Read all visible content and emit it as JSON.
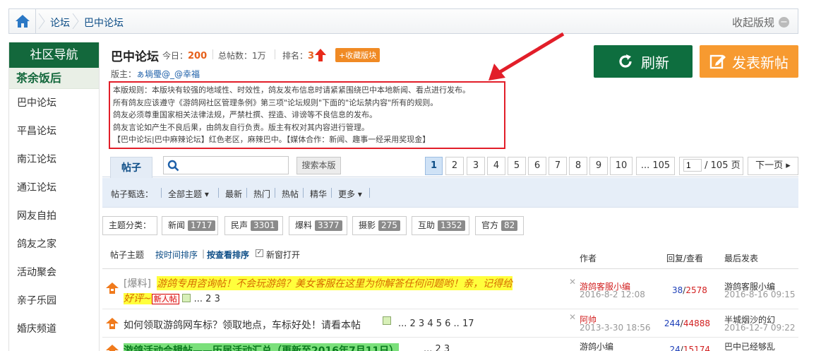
{
  "breadcrumb": {
    "items": [
      "论坛",
      "巴中论坛"
    ],
    "toggle_label": "收起版规",
    "toggle_icon": "minus-circle-icon"
  },
  "sidebar": {
    "title": "社区导航",
    "current": "茶余饭后",
    "items": [
      "巴中论坛",
      "平昌论坛",
      "南江论坛",
      "通江论坛",
      "网友自拍",
      "鸽友之家",
      "活动聚会",
      "亲子乐园",
      "婚庆频道"
    ]
  },
  "forum": {
    "name": "巴中论坛",
    "today_label": "今日：",
    "today_value": "200",
    "total_label": "总帖数：",
    "total_value": "1万",
    "rank_label": "排名：",
    "rank_value": "3",
    "fav_label": "+收藏版块",
    "moderator_label": "版主：",
    "moderator_name": "ぁ埫璺@_@幸福"
  },
  "actions": {
    "refresh_label": "刷新",
    "post_label": "发表新帖"
  },
  "rules": {
    "lines": [
      "本版规则：本版块有较强的地域性、时效性，鸽友发布信息时请紧紧围绕巴中本地新闻、看点进行发布。",
      "所有鸽友应该遵守《游鸽网社区管理条例》第三项\"论坛规则\"下面的\"论坛禁内容\"所有的规则。",
      "鸽友必须尊重国家相关法律法规，严禁杜撰、捏造、诽谤等不良信息的发布。",
      "鸽友言论如产生不良后果，由鸽友自行负责。版主有权对其内容进行管理。",
      "【巴中论坛|巴中麻辣论坛】红色老区，麻辣巴中。【媒体合作：新闻、趣事一经采用奖现金】"
    ]
  },
  "tabs": {
    "post_tab": "帖子",
    "search_placeholder": "",
    "search_button": "搜索本版"
  },
  "pager": {
    "pages": [
      "1",
      "2",
      "3",
      "4",
      "5",
      "6",
      "7",
      "8",
      "9",
      "10",
      "... 105"
    ],
    "current": "1",
    "input_value": "1",
    "total_label": "/ 105 页",
    "next_label": "下一页"
  },
  "filter": {
    "label": "帖子甄选：",
    "items": [
      "全部主题",
      "最新",
      "热门",
      "热帖",
      "精华",
      "更多"
    ]
  },
  "categories": {
    "label": "主题分类：",
    "items": [
      {
        "name": "新闻",
        "count": "1717"
      },
      {
        "name": "民声",
        "count": "3301"
      },
      {
        "name": "爆料",
        "count": "3377"
      },
      {
        "name": "摄影",
        "count": "275"
      },
      {
        "name": "互助",
        "count": "1352"
      },
      {
        "name": "官方",
        "count": "82"
      }
    ]
  },
  "thread_header": {
    "subject": "帖子主题",
    "sort_time": "按时间排序",
    "sort_view": "按查看排序",
    "new_window": "新窗打开",
    "author": "作者",
    "reply_view": "回复/查看",
    "last_post": "最后发表"
  },
  "threads": [
    {
      "tag": "[爆料]",
      "title_line1": "游鸽专用咨询帖！不会玩游鸽？美女客服在这里为你解答任何问题哟！亲，记得给",
      "title_line2": "好评~",
      "badge": "新人帖",
      "pages": "... 2 3",
      "author": "游鸽客服小编",
      "date": "2016-8-2 12:08",
      "replies": "38",
      "views": "2578",
      "last_author": "游鸽客服小编",
      "last_date": "2016-8-16 09:15"
    },
    {
      "title": "如何领取游鸽网车标？领取地点，车标好处！请看本帖",
      "pages": "... 2 3 4 5 6 .. 17",
      "author": "阿帅",
      "date": "2013-3-30 18:56",
      "replies": "244",
      "views": "44888",
      "last_author": "半城烟沙的幻",
      "last_date": "2016-12-7 09:22"
    },
    {
      "title": "游鸽活动合辑帖——历届活动汇总（更新至2016年7月11日）",
      "pages": "... 2 3",
      "author": "游鸽小编",
      "date": "",
      "replies": "24",
      "views": "15174",
      "last_author": "巴中已经够乱",
      "last_date": ""
    }
  ],
  "colors": {
    "sidebar_green": "#13683c",
    "refresh_green": "#0e6e3f",
    "post_orange": "#f79a30",
    "rules_border": "#e21e29",
    "link_blue": "#0d4d86"
  }
}
